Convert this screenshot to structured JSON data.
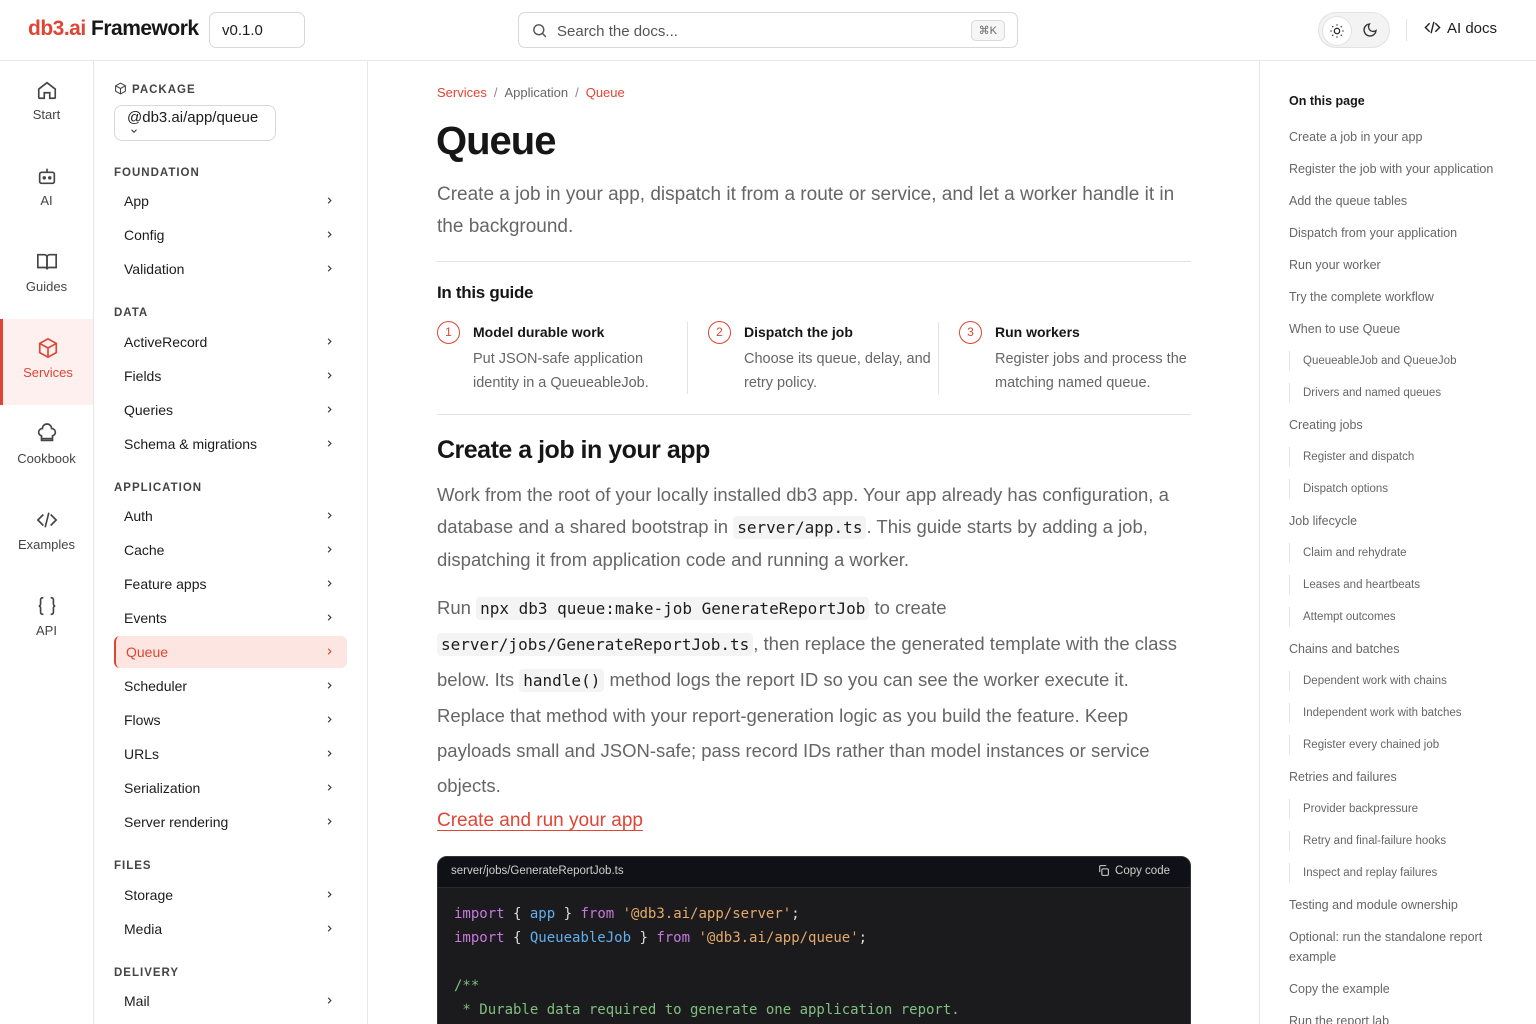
{
  "header": {
    "logo_brand": "db3.ai",
    "logo_rest": "Framework",
    "version": "v0.1.0",
    "search_placeholder": "Search the docs...",
    "search_shortcut": "⌘K",
    "ai_docs": "AI docs"
  },
  "rail": {
    "items": [
      {
        "label": "Start",
        "icon": "home-icon"
      },
      {
        "label": "AI",
        "icon": "robot-icon"
      },
      {
        "label": "Guides",
        "icon": "book-icon"
      },
      {
        "label": "Services",
        "icon": "cube-icon"
      },
      {
        "label": "Cookbook",
        "icon": "chef-hat-icon"
      },
      {
        "label": "Examples",
        "icon": "code-icon"
      },
      {
        "label": "API",
        "icon": "braces-icon"
      }
    ],
    "active": "Services"
  },
  "sidebar": {
    "package_label": "PACKAGE",
    "package_value": "@db3.ai/app/queue",
    "sections": [
      {
        "label": "FOUNDATION",
        "items": [
          "App",
          "Config",
          "Validation"
        ]
      },
      {
        "label": "DATA",
        "items": [
          "ActiveRecord",
          "Fields",
          "Queries",
          "Schema & migrations"
        ]
      },
      {
        "label": "APPLICATION",
        "items": [
          "Auth",
          "Cache",
          "Feature apps",
          "Events",
          "Queue",
          "Scheduler",
          "Flows",
          "URLs",
          "Serialization",
          "Server rendering"
        ]
      },
      {
        "label": "FILES",
        "items": [
          "Storage",
          "Media"
        ]
      },
      {
        "label": "DELIVERY",
        "items": [
          "Mail"
        ]
      }
    ],
    "active_item": "Queue"
  },
  "main": {
    "breadcrumb": [
      "Services",
      "Application",
      "Queue"
    ],
    "title": "Queue",
    "lead": "Create a job in your app, dispatch it from a route or service, and let a worker handle it in the background.",
    "guide_title": "In this guide",
    "steps": [
      {
        "num": "1",
        "title": "Model durable work",
        "desc": "Put JSON-safe application identity in a QueueableJob."
      },
      {
        "num": "2",
        "title": "Dispatch the job",
        "desc": "Choose its queue, delay, and retry policy."
      },
      {
        "num": "3",
        "title": "Run workers",
        "desc": "Register jobs and process the matching named queue."
      }
    ],
    "section_title": "Create a job in your app",
    "p1_a": "Work from the root of your locally installed db3 app. Your app already has configuration, a database and a shared bootstrap in ",
    "p1_code": "server/app.ts",
    "p1_b": ". This guide starts by adding a job, dispatching it from application code and running a worker.",
    "p2_a": "Run ",
    "p2_code1": "npx db3 queue:make-job GenerateReportJob",
    "p2_b": " to create ",
    "p2_code2": "server/jobs/GenerateReportJob.ts",
    "p2_c": ", then replace the generated template with the class below. Its ",
    "p2_code3": "handle()",
    "p2_d": " method logs the report ID so you can see the worker execute it. Replace that method with your report-generation logic as you build the feature. Keep payloads small and JSON-safe; pass record IDs rather than model instances or service objects.",
    "link": "Create and run your app",
    "code_file": "server/jobs/GenerateReportJob.ts",
    "copy_label": "Copy code",
    "code": {
      "import": "import",
      "from": "from",
      "app": "app",
      "queueable": "QueueableJob",
      "str1": "'@db3.ai/app/server'",
      "str2": "'@db3.ai/app/queue'",
      "comment1": "/**",
      "comment2": " * Durable data required to generate one application report."
    }
  },
  "toc": {
    "title": "On this page",
    "items": [
      {
        "label": "Create a job in your app",
        "sub": false
      },
      {
        "label": "Register the job with your application",
        "sub": false
      },
      {
        "label": "Add the queue tables",
        "sub": false
      },
      {
        "label": "Dispatch from your application",
        "sub": false
      },
      {
        "label": "Run your worker",
        "sub": false
      },
      {
        "label": "Try the complete workflow",
        "sub": false
      },
      {
        "label": "When to use Queue",
        "sub": false
      },
      {
        "label": "QueueableJob and QueueJob",
        "sub": true
      },
      {
        "label": "Drivers and named queues",
        "sub": true
      },
      {
        "label": "Creating jobs",
        "sub": false
      },
      {
        "label": "Register and dispatch",
        "sub": true
      },
      {
        "label": "Dispatch options",
        "sub": true
      },
      {
        "label": "Job lifecycle",
        "sub": false
      },
      {
        "label": "Claim and rehydrate",
        "sub": true
      },
      {
        "label": "Leases and heartbeats",
        "sub": true
      },
      {
        "label": "Attempt outcomes",
        "sub": true
      },
      {
        "label": "Chains and batches",
        "sub": false
      },
      {
        "label": "Dependent work with chains",
        "sub": true
      },
      {
        "label": "Independent work with batches",
        "sub": true
      },
      {
        "label": "Register every chained job",
        "sub": true
      },
      {
        "label": "Retries and failures",
        "sub": false
      },
      {
        "label": "Provider backpressure",
        "sub": true
      },
      {
        "label": "Retry and final-failure hooks",
        "sub": true
      },
      {
        "label": "Inspect and replay failures",
        "sub": true
      },
      {
        "label": "Testing and module ownership",
        "sub": false
      },
      {
        "label": "Optional: run the standalone report example",
        "sub": false
      },
      {
        "label": "Copy the example",
        "sub": false
      },
      {
        "label": "Run the report lab",
        "sub": false
      }
    ]
  },
  "colors": {
    "accent": "#e04434",
    "accent_bg": "#fde5e2",
    "code_bg": "#1b1b1d"
  }
}
